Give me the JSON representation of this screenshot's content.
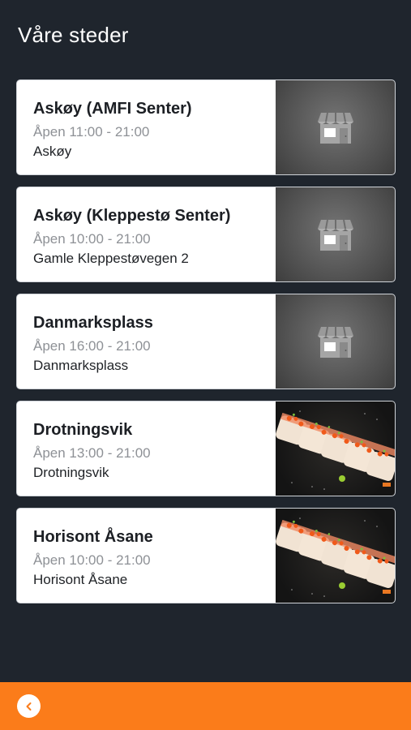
{
  "header": {
    "title": "Våre steder"
  },
  "locations": [
    {
      "name": "Askøy (AMFI Senter)",
      "hours": "Åpen 11:00 - 21:00",
      "address": "Askøy",
      "image": "store-icon"
    },
    {
      "name": "Askøy (Kleppestø Senter)",
      "hours": "Åpen 10:00 - 21:00",
      "address": "Gamle Kleppestøvegen 2",
      "image": "store-icon"
    },
    {
      "name": "Danmarksplass",
      "hours": "Åpen 16:00 - 21:00",
      "address": "Danmarksplass",
      "image": "store-icon"
    },
    {
      "name": "Drotningsvik",
      "hours": "Åpen 13:00 - 21:00",
      "address": "Drotningsvik",
      "image": "sushi-photo"
    },
    {
      "name": "Horisont Åsane",
      "hours": "Åpen 10:00 - 21:00",
      "address": "Horisont Åsane",
      "image": "sushi-photo"
    }
  ],
  "footer": {
    "back_icon": "chevron-left-icon"
  },
  "colors": {
    "background": "#1f252d",
    "accent": "#fb7c1a",
    "card": "#ffffff"
  }
}
